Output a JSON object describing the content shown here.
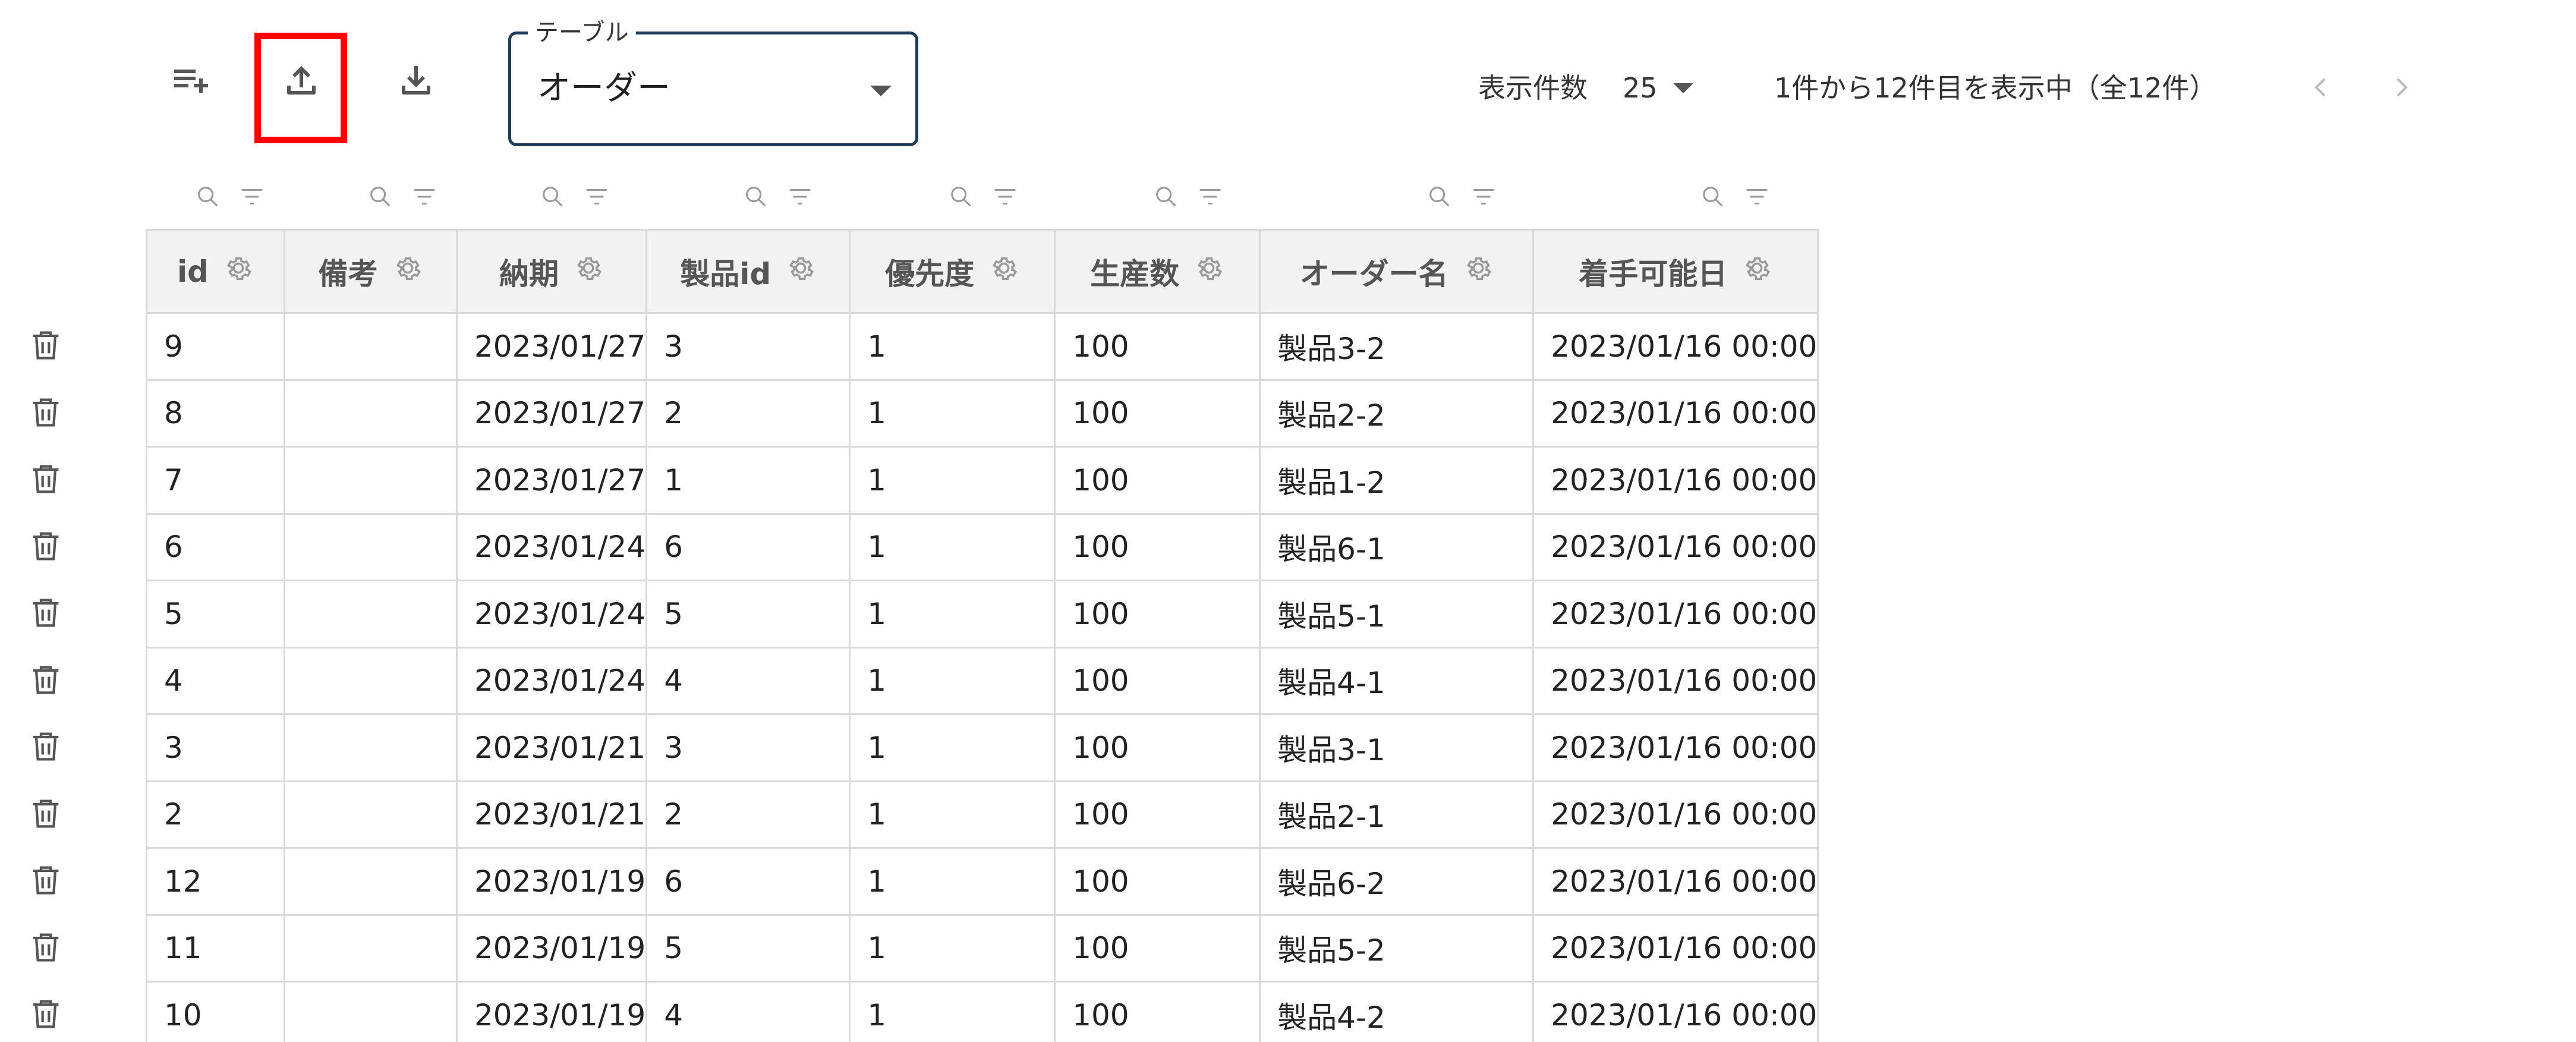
{
  "toolbar": {
    "add_rows_icon": "playlist-add-icon",
    "upload_icon": "upload-icon",
    "download_icon": "download-icon",
    "highlight_color": "#ff0000"
  },
  "table_select": {
    "legend": "テーブル",
    "value": "オーダー",
    "border_color": "#1f3b57"
  },
  "pagination": {
    "rows_per_page_label": "表示件数",
    "rows_per_page_value": "25",
    "range_info": "1件から12件目を表示中（全12件）"
  },
  "columns": [
    "id",
    "備考",
    "納期",
    "製品id",
    "優先度",
    "生産数",
    "オーダー名",
    "着手可能日"
  ],
  "rows": [
    [
      "9",
      "",
      "2023/01/27",
      "3",
      "1",
      "100",
      "製品3-2",
      "2023/01/16 00:00"
    ],
    [
      "8",
      "",
      "2023/01/27",
      "2",
      "1",
      "100",
      "製品2-2",
      "2023/01/16 00:00"
    ],
    [
      "7",
      "",
      "2023/01/27",
      "1",
      "1",
      "100",
      "製品1-2",
      "2023/01/16 00:00"
    ],
    [
      "6",
      "",
      "2023/01/24",
      "6",
      "1",
      "100",
      "製品6-1",
      "2023/01/16 00:00"
    ],
    [
      "5",
      "",
      "2023/01/24",
      "5",
      "1",
      "100",
      "製品5-1",
      "2023/01/16 00:00"
    ],
    [
      "4",
      "",
      "2023/01/24",
      "4",
      "1",
      "100",
      "製品4-1",
      "2023/01/16 00:00"
    ],
    [
      "3",
      "",
      "2023/01/21",
      "3",
      "1",
      "100",
      "製品3-1",
      "2023/01/16 00:00"
    ],
    [
      "2",
      "",
      "2023/01/21",
      "2",
      "1",
      "100",
      "製品2-1",
      "2023/01/16 00:00"
    ],
    [
      "12",
      "",
      "2023/01/19",
      "6",
      "1",
      "100",
      "製品6-2",
      "2023/01/16 00:00"
    ],
    [
      "11",
      "",
      "2023/01/19",
      "5",
      "1",
      "100",
      "製品5-2",
      "2023/01/16 00:00"
    ],
    [
      "10",
      "",
      "2023/01/19",
      "4",
      "1",
      "100",
      "製品4-2",
      "2023/01/16 00:00"
    ]
  ]
}
